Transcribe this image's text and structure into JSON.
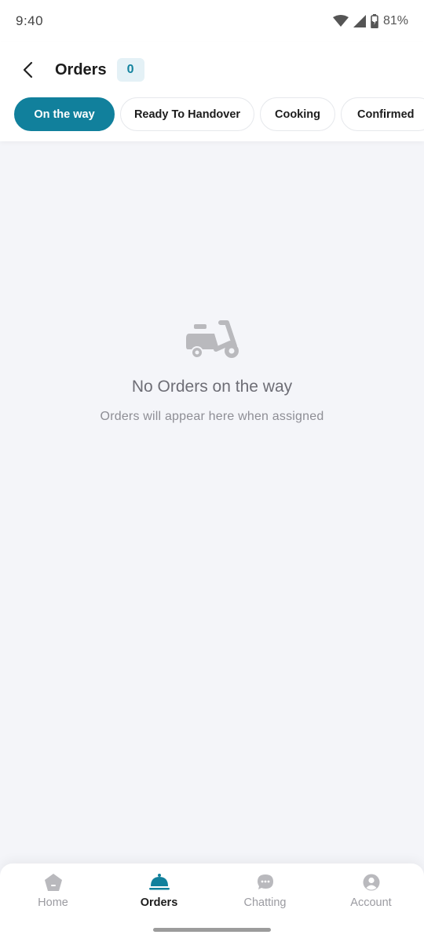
{
  "status_bar": {
    "time": "9:40",
    "battery": "81%"
  },
  "header": {
    "title": "Orders",
    "count": "0"
  },
  "tabs": [
    {
      "label": "On the way",
      "active": true
    },
    {
      "label": "Ready To Handover",
      "active": false
    },
    {
      "label": "Cooking",
      "active": false
    },
    {
      "label": "Confirmed",
      "active": false
    }
  ],
  "empty_state": {
    "icon": "scooter-icon",
    "title": "No Orders on the way",
    "subtitle": "Orders will appear here when assigned"
  },
  "bottom_nav": [
    {
      "label": "Home",
      "icon": "home-icon",
      "active": false
    },
    {
      "label": "Orders",
      "icon": "cloche-icon",
      "active": true
    },
    {
      "label": "Chatting",
      "icon": "chat-icon",
      "active": false
    },
    {
      "label": "Account",
      "icon": "user-icon",
      "active": false
    }
  ],
  "colors": {
    "accent": "#11809c",
    "badge_bg": "#e4f1f6",
    "background": "#f4f5f9",
    "muted_icon": "#b9b9bd"
  }
}
